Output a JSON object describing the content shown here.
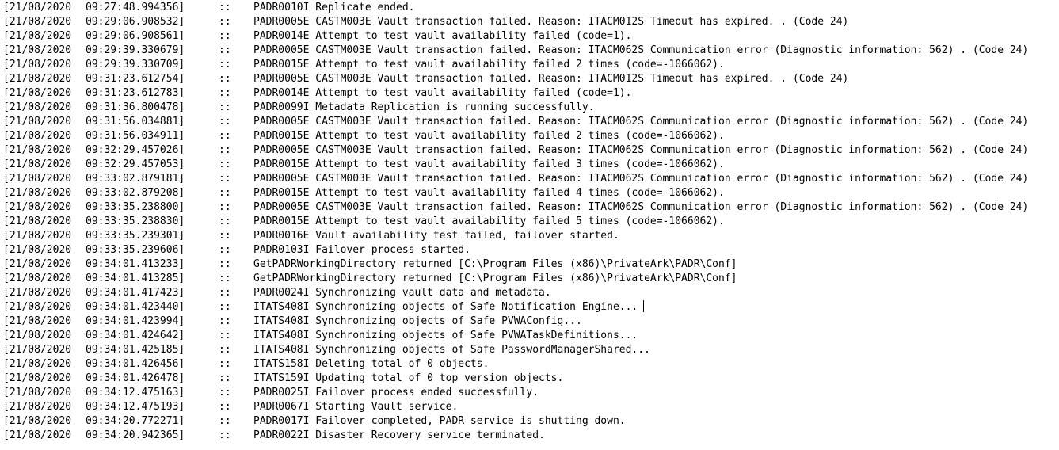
{
  "log": {
    "separator": "::",
    "entries": [
      {
        "date": "[21/08/2020",
        "time": "09:27:48.994356]",
        "message": "PADR0010I Replicate ended."
      },
      {
        "date": "[21/08/2020",
        "time": "09:29:06.908532]",
        "message": "PADR0005E CASTM003E Vault transaction failed. Reason: ITACM012S Timeout has expired. . (Code 24)"
      },
      {
        "date": "[21/08/2020",
        "time": "09:29:06.908561]",
        "message": "PADR0014E Attempt to test vault availability failed (code=1)."
      },
      {
        "date": "[21/08/2020",
        "time": "09:29:39.330679]",
        "message": "PADR0005E CASTM003E Vault transaction failed. Reason: ITACM062S Communication error (Diagnostic information: 562) . (Code 24)"
      },
      {
        "date": "[21/08/2020",
        "time": "09:29:39.330709]",
        "message": "PADR0015E Attempt to test vault availability failed 2 times (code=-1066062)."
      },
      {
        "date": "[21/08/2020",
        "time": "09:31:23.612754]",
        "message": "PADR0005E CASTM003E Vault transaction failed. Reason: ITACM012S Timeout has expired. . (Code 24)"
      },
      {
        "date": "[21/08/2020",
        "time": "09:31:23.612783]",
        "message": "PADR0014E Attempt to test vault availability failed (code=1)."
      },
      {
        "date": "[21/08/2020",
        "time": "09:31:36.800478]",
        "message": "PADR0099I Metadata Replication is running successfully."
      },
      {
        "date": "[21/08/2020",
        "time": "09:31:56.034881]",
        "message": "PADR0005E CASTM003E Vault transaction failed. Reason: ITACM062S Communication error (Diagnostic information: 562) . (Code 24)"
      },
      {
        "date": "[21/08/2020",
        "time": "09:31:56.034911]",
        "message": "PADR0015E Attempt to test vault availability failed 2 times (code=-1066062)."
      },
      {
        "date": "[21/08/2020",
        "time": "09:32:29.457026]",
        "message": "PADR0005E CASTM003E Vault transaction failed. Reason: ITACM062S Communication error (Diagnostic information: 562) . (Code 24)"
      },
      {
        "date": "[21/08/2020",
        "time": "09:32:29.457053]",
        "message": "PADR0015E Attempt to test vault availability failed 3 times (code=-1066062)."
      },
      {
        "date": "[21/08/2020",
        "time": "09:33:02.879181]",
        "message": "PADR0005E CASTM003E Vault transaction failed. Reason: ITACM062S Communication error (Diagnostic information: 562) . (Code 24)"
      },
      {
        "date": "[21/08/2020",
        "time": "09:33:02.879208]",
        "message": "PADR0015E Attempt to test vault availability failed 4 times (code=-1066062)."
      },
      {
        "date": "[21/08/2020",
        "time": "09:33:35.238800]",
        "message": "PADR0005E CASTM003E Vault transaction failed. Reason: ITACM062S Communication error (Diagnostic information: 562) . (Code 24)"
      },
      {
        "date": "[21/08/2020",
        "time": "09:33:35.238830]",
        "message": "PADR0015E Attempt to test vault availability failed 5 times (code=-1066062)."
      },
      {
        "date": "[21/08/2020",
        "time": "09:33:35.239301]",
        "message": "PADR0016E Vault availability test failed, failover started."
      },
      {
        "date": "[21/08/2020",
        "time": "09:33:35.239606]",
        "message": "PADR0103I Failover process started."
      },
      {
        "date": "[21/08/2020",
        "time": "09:34:01.413233]",
        "message": "GetPADRWorkingDirectory returned [C:\\Program Files (x86)\\PrivateArk\\PADR\\Conf]"
      },
      {
        "date": "[21/08/2020",
        "time": "09:34:01.413285]",
        "message": "GetPADRWorkingDirectory returned [C:\\Program Files (x86)\\PrivateArk\\PADR\\Conf]"
      },
      {
        "date": "[21/08/2020",
        "time": "09:34:01.417423]",
        "message": "PADR0024I Synchronizing vault data and metadata."
      },
      {
        "date": "[21/08/2020",
        "time": "09:34:01.423440]",
        "message": "ITATS408I Synchronizing objects of Safe Notification Engine...",
        "caret": true
      },
      {
        "date": "[21/08/2020",
        "time": "09:34:01.423994]",
        "message": "ITATS408I Synchronizing objects of Safe PVWAConfig..."
      },
      {
        "date": "[21/08/2020",
        "time": "09:34:01.424642]",
        "message": "ITATS408I Synchronizing objects of Safe PVWATaskDefinitions..."
      },
      {
        "date": "[21/08/2020",
        "time": "09:34:01.425185]",
        "message": "ITATS408I Synchronizing objects of Safe PasswordManagerShared..."
      },
      {
        "date": "[21/08/2020",
        "time": "09:34:01.426456]",
        "message": "ITATS158I Deleting total of 0 objects."
      },
      {
        "date": "[21/08/2020",
        "time": "09:34:01.426478]",
        "message": "ITATS159I Updating total of 0 top version objects."
      },
      {
        "date": "[21/08/2020",
        "time": "09:34:12.475163]",
        "message": "PADR0025I Failover process ended successfully."
      },
      {
        "date": "[21/08/2020",
        "time": "09:34:12.475193]",
        "message": "PADR0067I Starting Vault service."
      },
      {
        "date": "[21/08/2020",
        "time": "09:34:20.772271]",
        "message": "PADR0017I Failover completed, PADR service is shutting down."
      },
      {
        "date": "[21/08/2020",
        "time": "09:34:20.942365]",
        "message": "PADR0022I Disaster Recovery service terminated."
      }
    ]
  }
}
